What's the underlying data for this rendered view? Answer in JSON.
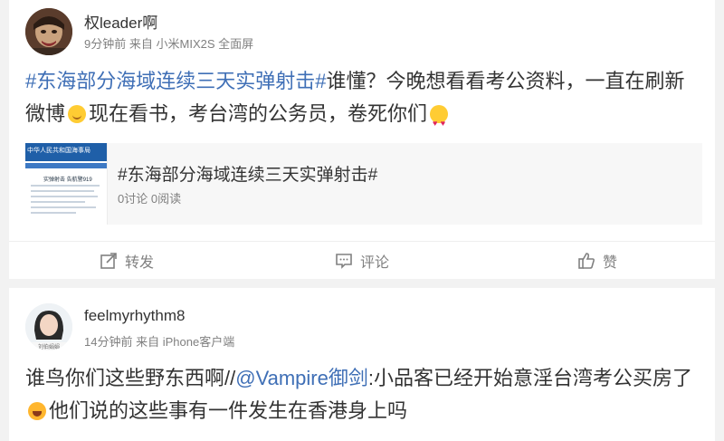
{
  "post1": {
    "username": "权leader啊",
    "time": "9分钟前",
    "source_prefix": "来自",
    "device": "小米MIX2S",
    "device_suffix": "全面屏",
    "topic": "#东海部分海域连续三天实弹射击#",
    "text_part1": "谁懂？今晚想看看考公资料，一直在刷新微博",
    "text_part2": "现在看书，考台湾的公务员，卷死你们",
    "share": {
      "thumb_title": "中华人民共和国海事局",
      "thumb_caption": "实弹射击 告航警919",
      "title": "#东海部分海域连续三天实弹射击#",
      "stats": "0讨论 0阅读"
    },
    "actions": {
      "repost": "转发",
      "comment": "评论",
      "like": "赞"
    }
  },
  "post2": {
    "username": "feelmyrhythm8",
    "avatar_caption": "刘伯娟娟",
    "time": "14分钟前",
    "source_prefix": "来自",
    "device": "iPhone客户端",
    "text_part1": "谁鸟你们这些野东西啊//",
    "mention": "@Vampire御剑",
    "text_part2": ":小品客已经开始意淫台湾考公买房了",
    "text_part3": "他们说的这些事有一件发生在香港身上吗"
  },
  "colors": {
    "link": "#3f6fb6",
    "meta": "#808080",
    "background": "#f2f2f2"
  }
}
